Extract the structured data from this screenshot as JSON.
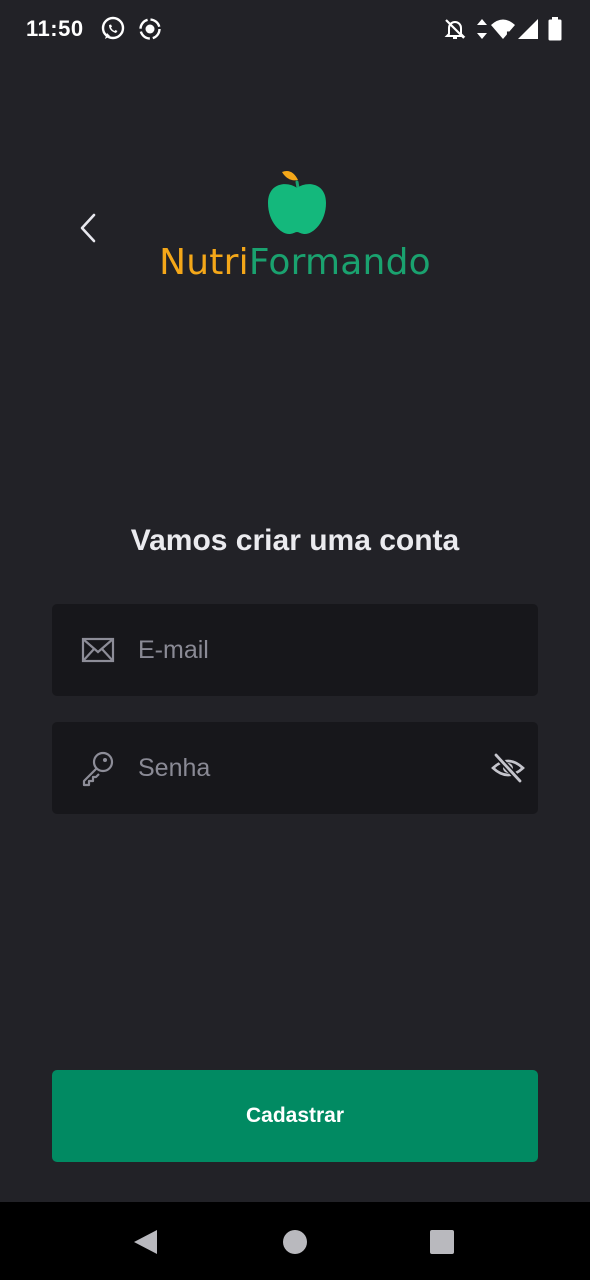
{
  "status_bar": {
    "time": "11:50",
    "icons": [
      "whatsapp-icon",
      "screen-record-icon",
      "notifications-off-icon",
      "data-arrows-icon",
      "wifi-icon",
      "signal-icon",
      "battery-icon"
    ]
  },
  "header": {
    "back_icon": "chevron-left-icon",
    "logo_icon": "apple-icon",
    "brand_part1": "Nutri",
    "brand_part2": "Formando",
    "brand_color_1": "#f4a719",
    "brand_color_2": "#1aa26f"
  },
  "form": {
    "title": "Vamos criar uma conta",
    "email": {
      "icon": "envelope-icon",
      "placeholder": "E-mail",
      "value": ""
    },
    "password": {
      "icon": "key-icon",
      "placeholder": "Senha",
      "value": "",
      "toggle_icon": "eye-off-icon"
    },
    "submit_label": "Cadastrar",
    "accent_color": "#018a62"
  },
  "nav_bar": {
    "items": [
      "back-triangle-icon",
      "home-circle-icon",
      "recents-square-icon"
    ]
  }
}
